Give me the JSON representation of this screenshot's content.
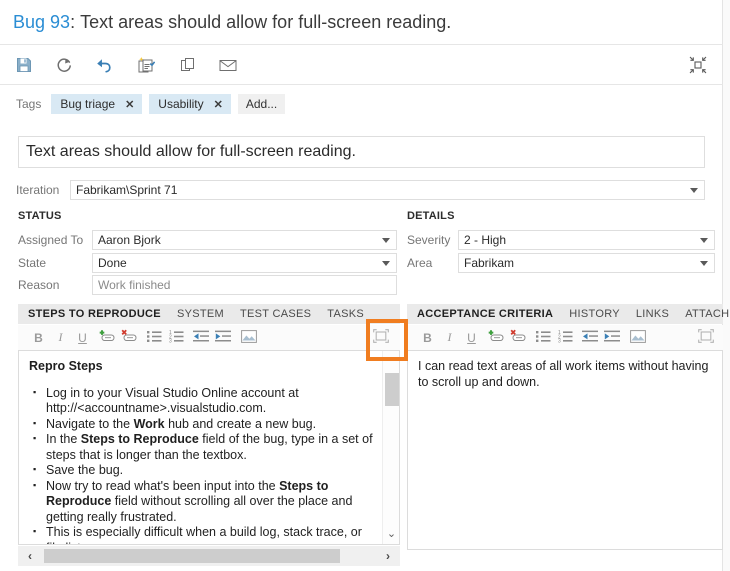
{
  "header": {
    "work_item_id": "Bug 93",
    "separator": ": ",
    "work_item_title": "Text areas should allow for full-screen reading.",
    "id_color": "#2a8dd4"
  },
  "toolbar": {
    "buttons": [
      {
        "name": "save-button",
        "label": "Save",
        "icon": "save-icon"
      },
      {
        "name": "refresh-button",
        "label": "Refresh",
        "icon": "refresh-icon"
      },
      {
        "name": "undo-button",
        "label": "Revert",
        "icon": "undo-icon"
      },
      {
        "name": "new-linked-item-button",
        "label": "New Linked Work Item",
        "icon": "new-linked-item-icon"
      },
      {
        "name": "copy-button",
        "label": "Copy",
        "icon": "copy-icon"
      },
      {
        "name": "email-button",
        "label": "Email",
        "icon": "email-icon"
      }
    ],
    "restore_button": {
      "name": "restore-button",
      "label": "Restore Down",
      "icon": "collapse-icon"
    }
  },
  "tags": {
    "label": "Tags",
    "items": [
      {
        "text": "Bug triage",
        "remove": "✕"
      },
      {
        "text": "Usability",
        "remove": "✕"
      }
    ],
    "add_label": "Add...",
    "tag_bg": "#d9e9f4"
  },
  "title_field": {
    "value": "Text areas should allow for full-screen reading."
  },
  "iteration": {
    "label": "Iteration",
    "value": "Fabrikam\\Sprint 71"
  },
  "status": {
    "header": "STATUS",
    "fields": [
      {
        "label": "Assigned To",
        "value": "Aaron Bjork",
        "dropdown": true
      },
      {
        "label": "State",
        "value": "Done",
        "dropdown": true
      },
      {
        "label": "Reason",
        "value": "Work finished",
        "dropdown": false
      }
    ]
  },
  "details": {
    "header": "DETAILS",
    "fields": [
      {
        "label": "Severity",
        "value": "2 - High",
        "dropdown": true
      },
      {
        "label": "Area",
        "value": "Fabrikam",
        "dropdown": true
      }
    ]
  },
  "left_panel": {
    "tabs": [
      {
        "label": "STEPS TO REPRODUCE",
        "active": true
      },
      {
        "label": "SYSTEM",
        "active": false
      },
      {
        "label": "TEST CASES",
        "active": false
      },
      {
        "label": "TASKS",
        "active": false
      }
    ],
    "rich_text_toolbar": [
      {
        "name": "bold-icon",
        "label": "Bold"
      },
      {
        "name": "italic-icon",
        "label": "Italic"
      },
      {
        "name": "underline-icon",
        "label": "Underline"
      },
      {
        "name": "insert-link-icon",
        "label": "Insert hyperlink"
      },
      {
        "name": "remove-link-icon",
        "label": "Remove hyperlink"
      },
      {
        "name": "bullet-list-icon",
        "label": "Bulleted list"
      },
      {
        "name": "numbered-list-icon",
        "label": "Numbered list"
      },
      {
        "name": "decrease-indent-icon",
        "label": "Decrease indent"
      },
      {
        "name": "increase-indent-icon",
        "label": "Increase indent"
      },
      {
        "name": "insert-image-icon",
        "label": "Insert image"
      },
      {
        "name": "full-screen-icon",
        "label": "Full screen"
      }
    ],
    "content_title": "Repro Steps",
    "steps": [
      [
        {
          "t": "Log in to your Visual Studio Online account at http://<accountname>.visualstudio.com.",
          "b": false
        }
      ],
      [
        {
          "t": "Navigate to the ",
          "b": false
        },
        {
          "t": "Work",
          "b": true
        },
        {
          "t": " hub and create a new bug.",
          "b": false
        }
      ],
      [
        {
          "t": "In the ",
          "b": false
        },
        {
          "t": "Steps to Reproduce",
          "b": true
        },
        {
          "t": " field of the bug, type in a set of steps that is longer than the textbox.",
          "b": false
        }
      ],
      [
        {
          "t": "Save the bug.",
          "b": false
        }
      ],
      [
        {
          "t": "Now try to read what's been input into the ",
          "b": false
        },
        {
          "t": "Steps to Reproduce",
          "b": true
        },
        {
          "t": " field without scrolling all over the place and getting really frustrated.",
          "b": false
        }
      ],
      [
        {
          "t": "This is especially difficult when a build log, stack trace, or file list",
          "b": false
        }
      ]
    ],
    "scroll": {
      "up_arrow": "⌃",
      "down_arrow": "⌄",
      "left_arrow": "‹",
      "right_arrow": "›"
    }
  },
  "right_panel": {
    "tabs": [
      {
        "label": "ACCEPTANCE CRITERIA",
        "active": true
      },
      {
        "label": "HISTORY",
        "active": false
      },
      {
        "label": "LINKS",
        "active": false
      },
      {
        "label": "ATTACHMENT",
        "active": false
      }
    ],
    "content": "I can read text areas of all work items without having to scroll up and down."
  },
  "highlight": {
    "color": "#f07d20",
    "target": "full-screen-icon"
  }
}
